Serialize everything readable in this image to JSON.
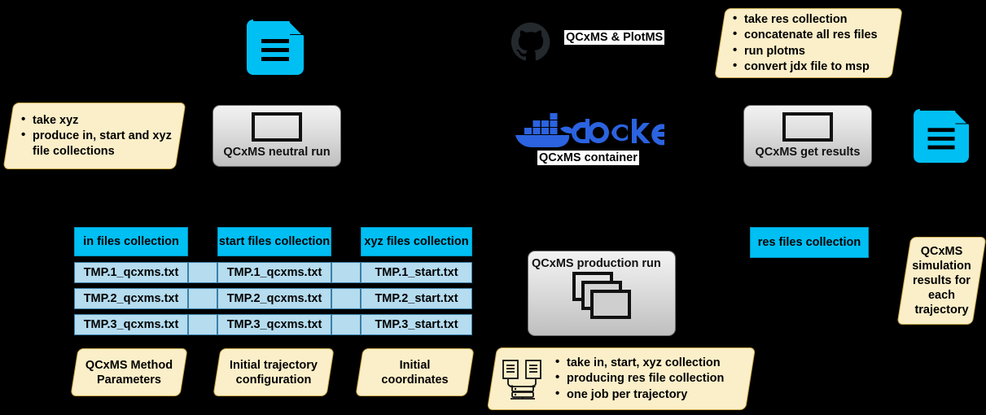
{
  "diagram": {
    "title": "QCxMS workflow diagram",
    "colors": {
      "background": "#000000",
      "note_fill": "#FBEFC9",
      "note_border": "#C8A84B",
      "cyan_header": "#00BFF3",
      "cell_fill": "#B5DCEF",
      "cell_border": "#3A7FA8",
      "doc_icon": "#00BFF3",
      "docker_blue": "#2B63E0",
      "github_dark": "#24292E",
      "button_gray": "#E2E2E2"
    }
  },
  "notes": {
    "neutral_run_note": {
      "items": [
        "take xyz",
        "produce in, start and xyz file collections"
      ]
    },
    "get_results_note": {
      "items": [
        "take res collection",
        "concatenate all res files",
        "run plotms",
        "convert jdx file to msp"
      ]
    },
    "production_run_note": {
      "icon": "documents-to-server-icon",
      "items": [
        "take in, start, xyz collection",
        "producing res file collection",
        "one job per trajectory"
      ]
    },
    "method_parameters": {
      "text": "QCxMS Method Parameters"
    },
    "trajectory_configuration": {
      "text": "Initial trajectory configuration"
    },
    "initial_coordinates": {
      "text": "Initial coordinates"
    },
    "simulation_results": {
      "text": "QCxMS simulation results for each trajectory"
    }
  },
  "icons": {
    "doc_top_left": "document-icon",
    "doc_top_right": "document-icon",
    "github": "github-icon",
    "docker": "docker-icon"
  },
  "brands": {
    "github_label": "QCxMS & PlotMS",
    "docker_label": "QCxMS container"
  },
  "buttons": {
    "neutral_run": {
      "label": "QCxMS neutral run",
      "glyph": "rectangle-glyph"
    },
    "get_results": {
      "label": "QCxMS get results",
      "glyph": "rectangle-glyph"
    },
    "production_run": {
      "label": "QCxMS production run",
      "glyph": "stacked-windows-glyph"
    }
  },
  "tables": [
    {
      "header": "in files collection",
      "rows": [
        "TMP.1_qcxms.txt",
        "TMP.2_qcxms.txt",
        "TMP.3_qcxms.txt"
      ]
    },
    {
      "header": "start files collection",
      "rows": [
        "TMP.1_qcxms.txt",
        "TMP.2_qcxms.txt",
        "TMP.3_qcxms.txt"
      ]
    },
    {
      "header": "xyz files collection",
      "rows": [
        "TMP.1_start.txt",
        "TMP.2_start.txt",
        "TMP.3_start.txt"
      ]
    }
  ],
  "res_collection": {
    "header": "res files collection"
  }
}
